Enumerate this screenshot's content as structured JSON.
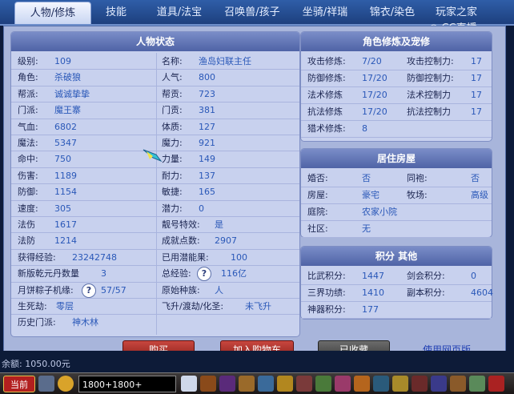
{
  "tabs": [
    "人物/修炼",
    "技能",
    "道具/法宝",
    "召唤兽/孩子",
    "坐骑/祥瑞",
    "锦衣/染色",
    "玩家之家"
  ],
  "watermark": "CC直播",
  "status_panel": {
    "title": "人物状态",
    "left_rows": [
      {
        "label": "级别:",
        "value": "109"
      },
      {
        "label": "角色:",
        "value": "杀破狼"
      },
      {
        "label": "帮派:",
        "value": "诚诚挚挚"
      },
      {
        "label": "门派:",
        "value": "魔王寨"
      },
      {
        "label": "气血:",
        "value": "6802"
      },
      {
        "label": "魔法:",
        "value": "5347"
      },
      {
        "label": "命中:",
        "value": "750"
      },
      {
        "label": "伤害:",
        "value": "1189"
      },
      {
        "label": "防御:",
        "value": "1154"
      },
      {
        "label": "速度:",
        "value": "305"
      },
      {
        "label": "法伤",
        "value": "1617"
      },
      {
        "label": "法防",
        "value": "1214"
      },
      {
        "label": "获得经验:",
        "value": "23242748"
      },
      {
        "label": "新版乾元丹数量",
        "value": "3"
      },
      {
        "label": "月饼粽子机缘:",
        "value": "57/57"
      },
      {
        "label": "生死劫:",
        "value": "零层"
      },
      {
        "label": "历史门派:",
        "value": "神木林"
      }
    ],
    "right_rows": [
      {
        "label": "名称:",
        "value": "渔岛妇联主任"
      },
      {
        "label": "人气:",
        "value": "800"
      },
      {
        "label": "帮贡:",
        "value": "723"
      },
      {
        "label": "门贡:",
        "value": "381"
      },
      {
        "label": "体质:",
        "value": "127"
      },
      {
        "label": "魔力:",
        "value": "921"
      },
      {
        "label": "力量:",
        "value": "149"
      },
      {
        "label": "耐力:",
        "value": "137"
      },
      {
        "label": "敏捷:",
        "value": "165"
      },
      {
        "label": "潜力:",
        "value": "0"
      },
      {
        "label": "靓号特效:",
        "value": "是"
      },
      {
        "label": "成就点数:",
        "value": "2907"
      },
      {
        "label": "已用潜能果:",
        "value": "100"
      },
      {
        "label": "总经验:",
        "value": "116亿"
      },
      {
        "label": "原始种族:",
        "value": "人"
      },
      {
        "label": "飞升/渡劫/化圣:",
        "value": "未飞升"
      }
    ],
    "help_symbol": "?"
  },
  "cultivation_panel": {
    "title": "角色修炼及宠修",
    "rows": [
      {
        "l1": "攻击修炼:",
        "v1": "7/20",
        "l2": "攻击控制力:",
        "v2": "17"
      },
      {
        "l1": "防御修炼:",
        "v1": "17/20",
        "l2": "防御控制力:",
        "v2": "17"
      },
      {
        "l1": "法术修炼",
        "v1": "17/20",
        "l2": "法术控制力",
        "v2": "17"
      },
      {
        "l1": "抗法修炼",
        "v1": "17/20",
        "l2": "抗法控制力",
        "v2": "17"
      },
      {
        "l1": "猎术修炼:",
        "v1": "8",
        "l2": "",
        "v2": ""
      }
    ]
  },
  "house_panel": {
    "title": "居住房屋",
    "rows": [
      {
        "l1": "婚否:",
        "v1": "否",
        "l2": "同袍:",
        "v2": "否"
      },
      {
        "l1": "房屋:",
        "v1": "豪宅",
        "l2": "牧场:",
        "v2": "高级"
      },
      {
        "l1": "庭院:",
        "v1": "农家小院",
        "l2": "",
        "v2": ""
      },
      {
        "l1": "社区:",
        "v1": "无",
        "l2": "",
        "v2": ""
      }
    ]
  },
  "points_panel": {
    "title": "积分 其他",
    "rows": [
      {
        "l1": "比武积分:",
        "v1": "1447",
        "l2": "剑会积分:",
        "v2": "0"
      },
      {
        "l1": "三界功绩:",
        "v1": "1410",
        "l2": "副本积分:",
        "v2": "4604"
      },
      {
        "l1": "神器积分:",
        "v1": "177",
        "l2": "",
        "v2": ""
      }
    ]
  },
  "buttons": {
    "buy": "购买",
    "add_cart": "加入购物车",
    "collected": "已收藏",
    "web_version": "使用网页版"
  },
  "outside": {
    "fragment": "余额: 1050.00元"
  },
  "taskbar": {
    "start": "当前",
    "field": "1800+1800+"
  },
  "colors": {
    "value_blue": "#2a58b8",
    "button_red": "#b3352d",
    "panel_header": "#5a6eb0"
  }
}
